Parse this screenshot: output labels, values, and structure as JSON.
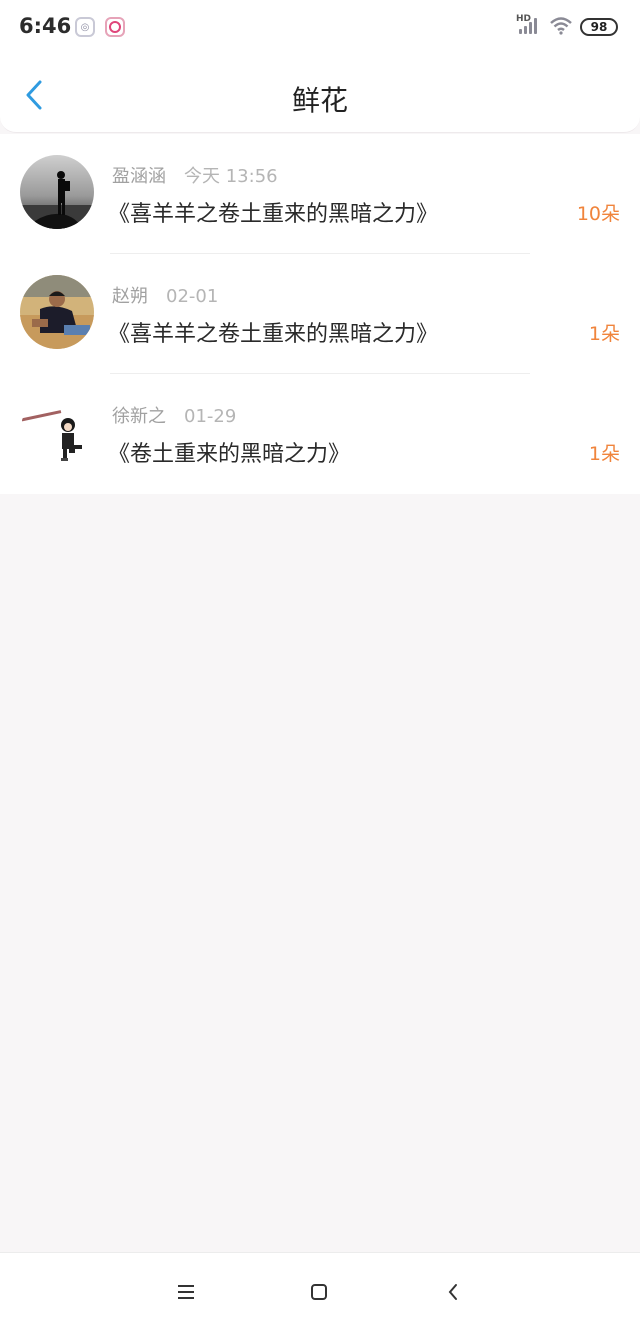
{
  "status": {
    "time": "6:46",
    "network": "HD",
    "battery": "98"
  },
  "header": {
    "title": "鲜花"
  },
  "items": [
    {
      "name": "盈涵涵",
      "time": "今天 13:56",
      "title": "《喜羊羊之卷土重来的黑暗之力》",
      "count": "10朵"
    },
    {
      "name": "赵朔",
      "time": "02-01",
      "title": "《喜羊羊之卷土重来的黑暗之力》",
      "count": "1朵"
    },
    {
      "name": "徐新之",
      "time": "01-29",
      "title": "《卷土重来的黑暗之力》",
      "count": "1朵"
    }
  ],
  "colors": {
    "accent": "#2f9be0",
    "count": "#f0843c",
    "background": "#f8f6f7"
  }
}
